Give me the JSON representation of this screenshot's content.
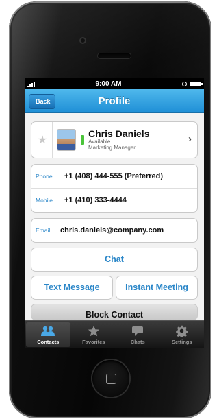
{
  "status_bar": {
    "time": "9:00 AM"
  },
  "nav": {
    "back_label": "Back",
    "title": "Profile"
  },
  "profile": {
    "name": "Chris Daniels",
    "availability": "Available",
    "job_title": "Marketing Manager",
    "presence_color": "#4bc43a"
  },
  "phones": [
    {
      "label": "Phone",
      "value": "+1 (408) 444-555 (Preferred)"
    },
    {
      "label": "Mobile",
      "value": "+1 (410) 333-4444"
    }
  ],
  "email": {
    "label": "Email",
    "value": "chris.daniels@company.com"
  },
  "actions": {
    "chat": "Chat",
    "text_message": "Text Message",
    "instant_meeting": "Instant Meeting",
    "block_contact": "Block Contact"
  },
  "tabs": [
    {
      "label": "Contacts",
      "icon": "people-icon",
      "active": true
    },
    {
      "label": "Favorites",
      "icon": "star-icon",
      "active": false
    },
    {
      "label": "Chats",
      "icon": "chat-bubble-icon",
      "active": false
    },
    {
      "label": "Settings",
      "icon": "gear-icon",
      "active": false
    }
  ],
  "colors": {
    "accent": "#2a86c8",
    "navbar": "#1f8fd6"
  }
}
